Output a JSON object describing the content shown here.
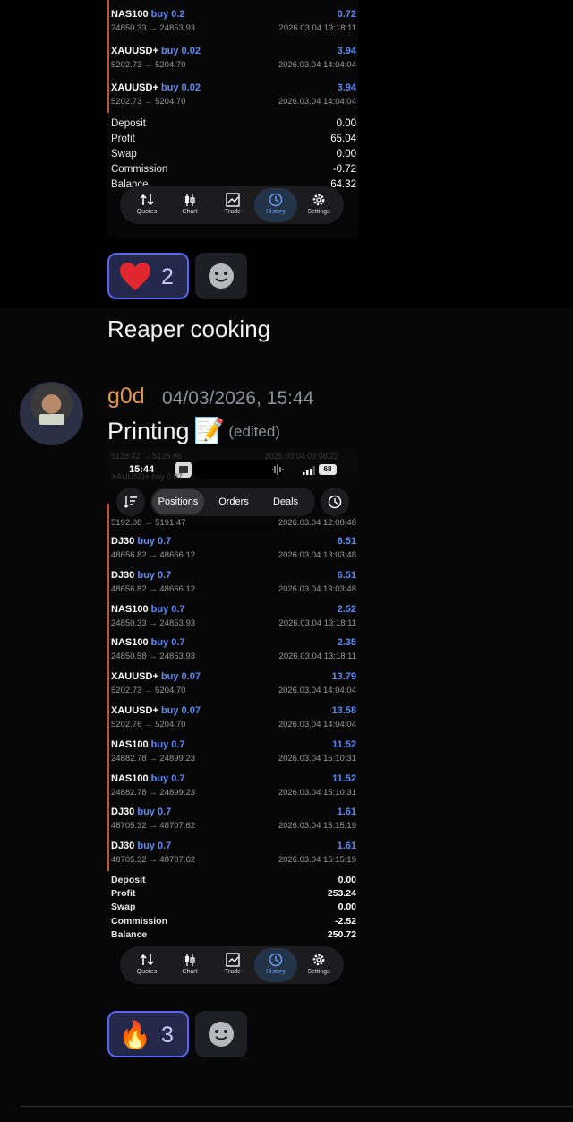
{
  "screenshot_1": {
    "trades": [
      {
        "symbol": "NAS100",
        "side": "buy 0.2",
        "prices": "24850.33 → 24853.93",
        "profit": "0.72",
        "time": "2026.03.04 13:18:11"
      },
      {
        "symbol": "XAUUSD+",
        "side": "buy 0.02",
        "prices": "5202.73 → 5204.70",
        "profit": "3.94",
        "time": "2026.03.04 14:04:04"
      },
      {
        "symbol": "XAUUSD+",
        "side": "buy 0.02",
        "prices": "5202.73 → 5204.70",
        "profit": "3.94",
        "time": "2026.03.04 14:04:04"
      }
    ],
    "summary": [
      {
        "label": "Deposit",
        "value": "0.00"
      },
      {
        "label": "Profit",
        "value": "65.04"
      },
      {
        "label": "Swap",
        "value": "0.00"
      },
      {
        "label": "Commission",
        "value": "-0.72"
      },
      {
        "label": "Balance",
        "value": "64.32"
      }
    ]
  },
  "nav": {
    "quotes": "Quotes",
    "chart": "Chart",
    "trade": "Trade",
    "history": "History",
    "settings": "Settings"
  },
  "reaction_1": {
    "emoji": "heart",
    "count": "2"
  },
  "message_1": {
    "text": "Reaper cooking"
  },
  "message_2": {
    "author": "g0d",
    "timestamp": "04/03/2026, 15:44",
    "text": "Printing",
    "emoji": "📝",
    "edited": "(edited)"
  },
  "screenshot_2": {
    "status_time": "15:44",
    "battery": "68",
    "tabs": {
      "positions": "Positions",
      "orders": "Orders",
      "deals": "Deals"
    },
    "partial_row": {
      "prices": "5192.08 → 5191.47",
      "time": "2026.03.04 12:08:48"
    },
    "trades": [
      {
        "symbol": "DJ30",
        "side": "buy 0.7",
        "prices": "48656.82 → 48666.12",
        "profit": "6.51",
        "time": "2026.03.04 13:03:48"
      },
      {
        "symbol": "DJ30",
        "side": "buy 0.7",
        "prices": "48656.82 → 48666.12",
        "profit": "6.51",
        "time": "2026.03.04 13:03:48"
      },
      {
        "symbol": "NAS100",
        "side": "buy 0.7",
        "prices": "24850.33 → 24853.93",
        "profit": "2.52",
        "time": "2026.03.04 13:18:11"
      },
      {
        "symbol": "NAS100",
        "side": "buy 0.7",
        "prices": "24850.58 → 24853.93",
        "profit": "2.35",
        "time": "2026.03.04 13:18:11"
      },
      {
        "symbol": "XAUUSD+",
        "side": "buy 0.07",
        "prices": "5202.73 → 5204.70",
        "profit": "13.79",
        "time": "2026.03.04 14:04:04"
      },
      {
        "symbol": "XAUUSD+",
        "side": "buy 0.07",
        "prices": "5202.76 → 5204.70",
        "profit": "13.58",
        "time": "2026.03.04 14:04:04"
      },
      {
        "symbol": "NAS100",
        "side": "buy 0.7",
        "prices": "24882.78 → 24899.23",
        "profit": "11.52",
        "time": "2026.03.04 15:10:31"
      },
      {
        "symbol": "NAS100",
        "side": "buy 0.7",
        "prices": "24882.78 → 24899.23",
        "profit": "11.52",
        "time": "2026.03.04 15:10:31"
      },
      {
        "symbol": "DJ30",
        "side": "buy 0.7",
        "prices": "48705.32 → 48707.62",
        "profit": "1.61",
        "time": "2026.03.04 15:15:19"
      },
      {
        "symbol": "DJ30",
        "side": "buy 0.7",
        "prices": "48705.32 → 48707.62",
        "profit": "1.61",
        "time": "2026.03.04 15:15:19"
      }
    ],
    "summary": [
      {
        "label": "Deposit",
        "value": "0.00"
      },
      {
        "label": "Profit",
        "value": "253.24"
      },
      {
        "label": "Swap",
        "value": "0.00"
      },
      {
        "label": "Commission",
        "value": "-2.52"
      },
      {
        "label": "Balance",
        "value": "250.72"
      }
    ]
  },
  "reaction_2": {
    "emoji": "🔥",
    "count": "3"
  },
  "colors": {
    "accent_blue": "#5b8bf5",
    "author": "#e8964a",
    "reaction_border": "#5865f2"
  }
}
